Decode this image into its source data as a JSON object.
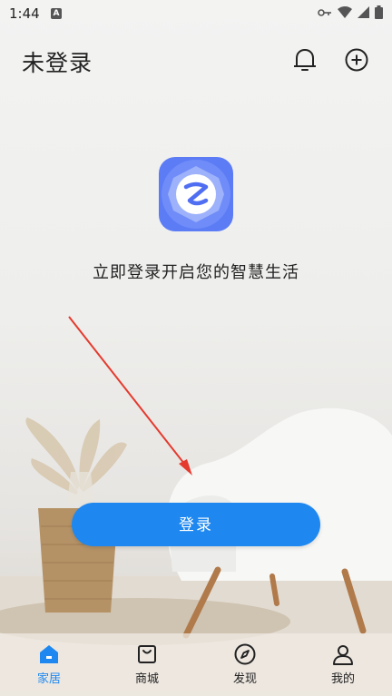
{
  "status_bar": {
    "time": "1:44"
  },
  "header": {
    "title": "未登录"
  },
  "center": {
    "tagline": "立即登录开启您的智慧生活"
  },
  "login": {
    "label": "登录"
  },
  "nav": [
    {
      "label": "家居",
      "icon": "home-icon",
      "active": true
    },
    {
      "label": "商城",
      "icon": "shopping-bag-icon",
      "active": false
    },
    {
      "label": "发现",
      "icon": "compass-icon",
      "active": false
    },
    {
      "label": "我的",
      "icon": "user-icon",
      "active": false
    }
  ],
  "colors": {
    "accent": "#1e88f0",
    "logo": "#5c7cf6",
    "arrow": "#e53a2e"
  }
}
